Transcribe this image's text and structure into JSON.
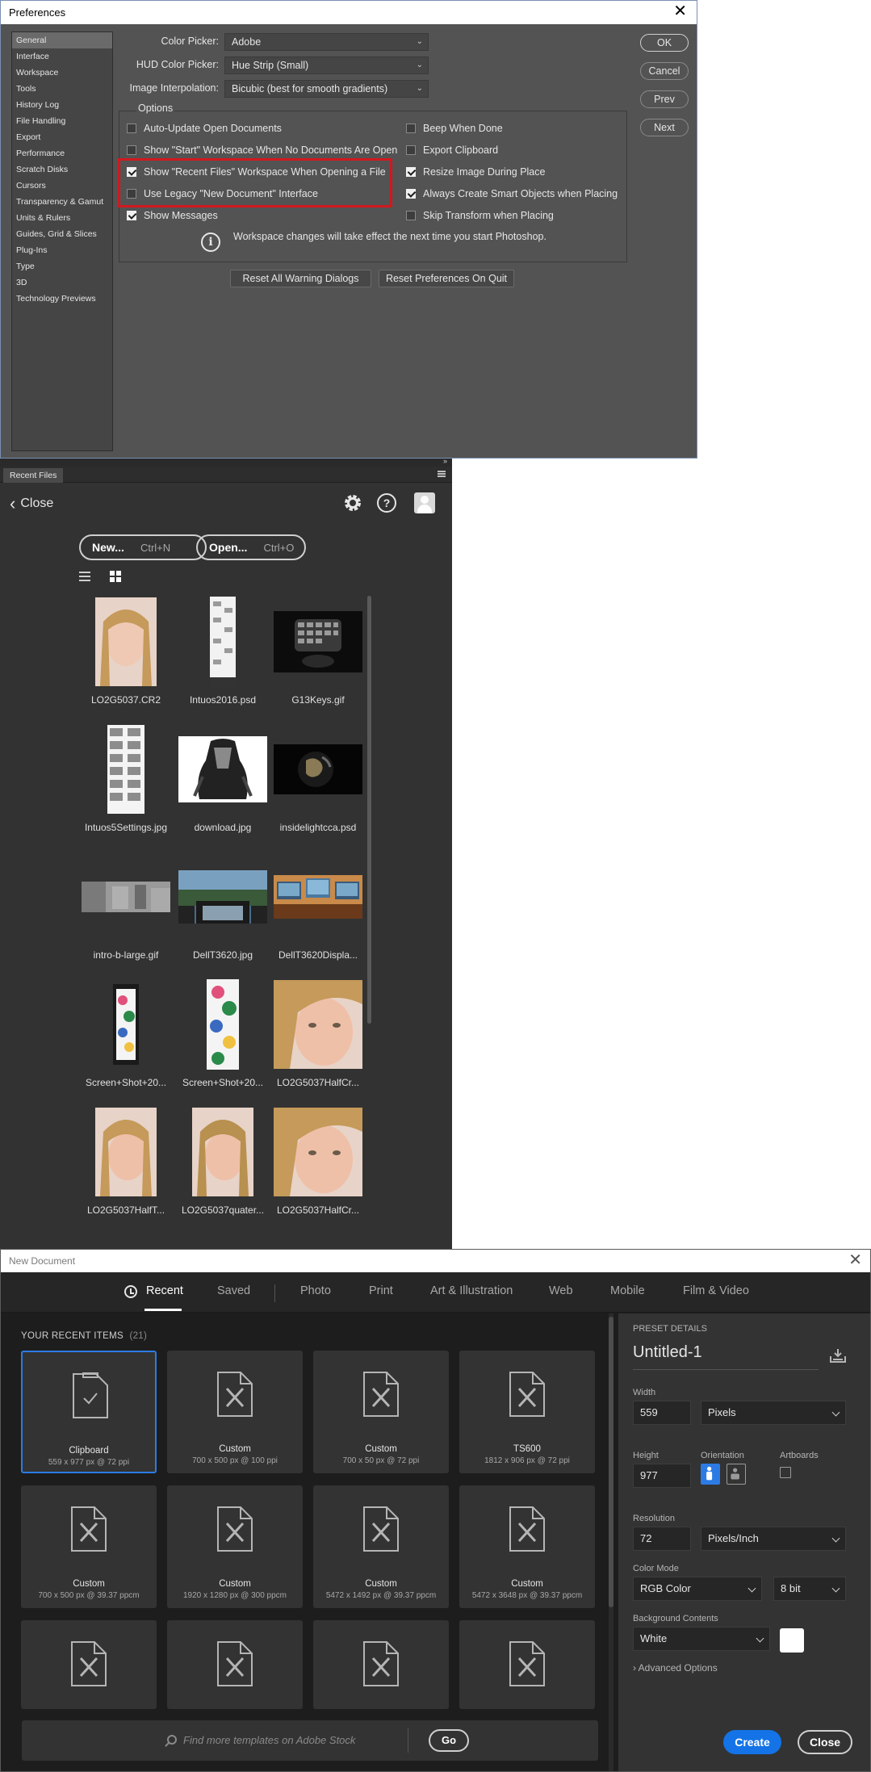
{
  "preferences": {
    "title": "Preferences",
    "sidebar": [
      "General",
      "Interface",
      "Workspace",
      "Tools",
      "History Log",
      "File Handling",
      "Export",
      "Performance",
      "Scratch Disks",
      "Cursors",
      "Transparency & Gamut",
      "Units & Rulers",
      "Guides, Grid & Slices",
      "Plug-Ins",
      "Type",
      "3D",
      "Technology Previews"
    ],
    "color_picker_label": "Color Picker:",
    "color_picker_value": "Adobe",
    "hud_picker_label": "HUD Color Picker:",
    "hud_picker_value": "Hue Strip (Small)",
    "interp_label": "Image Interpolation:",
    "interp_value": "Bicubic (best for smooth gradients)",
    "options_legend": "Options",
    "options_left": [
      {
        "label": "Auto-Update Open Documents",
        "checked": false
      },
      {
        "label": "Show \"Start\" Workspace When No Documents Are Open",
        "checked": false
      },
      {
        "label": "Show \"Recent Files\" Workspace When Opening a File",
        "checked": true
      },
      {
        "label": "Use Legacy \"New Document\" Interface",
        "checked": false
      },
      {
        "label": "Show Messages",
        "checked": true
      }
    ],
    "options_right": [
      {
        "label": "Beep When Done",
        "checked": false
      },
      {
        "label": "Export Clipboard",
        "checked": false
      },
      {
        "label": "Resize Image During Place",
        "checked": true
      },
      {
        "label": "Always Create Smart Objects when Placing",
        "checked": true
      },
      {
        "label": "Skip Transform when Placing",
        "checked": false
      }
    ],
    "info_text": "Workspace changes will take effect the next time you start Photoshop.",
    "reset_warnings": "Reset All Warning Dialogs",
    "reset_prefs": "Reset Preferences On Quit",
    "buttons": {
      "ok": "OK",
      "cancel": "Cancel",
      "prev": "Prev",
      "next": "Next"
    }
  },
  "recent_files": {
    "tab": "Recent Files",
    "back_label": "Close",
    "new_label": "New...",
    "new_shortcut": "Ctrl+N",
    "open_label": "Open...",
    "open_shortcut": "Ctrl+O",
    "files": [
      "LO2G5037.CR2",
      "Intuos2016.psd",
      "G13Keys.gif",
      "Intuos5Settings.jpg",
      "download.jpg",
      "insidelightcca.psd",
      "intro-b-large.gif",
      "DellT3620.jpg",
      "DellT3620Displa...",
      "Screen+Shot+20...",
      "Screen+Shot+20...",
      "LO2G5037HalfCr...",
      "LO2G5037HalfT...",
      "LO2G5037quater...",
      "LO2G5037HalfCr..."
    ]
  },
  "new_document": {
    "title": "New Document",
    "tabs": [
      "Recent",
      "Saved",
      "Photo",
      "Print",
      "Art & Illustration",
      "Web",
      "Mobile",
      "Film & Video"
    ],
    "recent_heading": "YOUR RECENT ITEMS",
    "recent_count": "(21)",
    "cards": [
      {
        "name": "Clipboard",
        "size": "559 x 977 px @ 72 ppi"
      },
      {
        "name": "Custom",
        "size": "700 x 500 px @ 100 ppi"
      },
      {
        "name": "Custom",
        "size": "700 x 50 px @ 72 ppi"
      },
      {
        "name": "TS600",
        "size": "1812 x 906 px @ 72 ppi"
      },
      {
        "name": "Custom",
        "size": "700 x 500 px @ 39.37 ppcm"
      },
      {
        "name": "Custom",
        "size": "1920 x 1280 px @ 300 ppcm"
      },
      {
        "name": "Custom",
        "size": "5472 x 1492 px @ 39.37 ppcm"
      },
      {
        "name": "Custom",
        "size": "5472 x 3648 px @ 39.37 ppcm"
      },
      {
        "name": "",
        "size": ""
      },
      {
        "name": "",
        "size": ""
      },
      {
        "name": "",
        "size": ""
      },
      {
        "name": "",
        "size": ""
      }
    ],
    "search_placeholder": "Find more templates on Adobe Stock",
    "go_label": "Go",
    "preset": {
      "heading": "PRESET DETAILS",
      "name": "Untitled-1",
      "width_label": "Width",
      "width_value": "559",
      "width_unit": "Pixels",
      "height_label": "Height",
      "height_value": "977",
      "orientation_label": "Orientation",
      "artboards_label": "Artboards",
      "resolution_label": "Resolution",
      "resolution_value": "72",
      "resolution_unit": "Pixels/Inch",
      "color_mode_label": "Color Mode",
      "color_mode_value": "RGB Color",
      "bit_depth": "8 bit",
      "bg_label": "Background Contents",
      "bg_value": "White",
      "advanced": "Advanced Options"
    },
    "create_label": "Create",
    "close_label": "Close"
  }
}
